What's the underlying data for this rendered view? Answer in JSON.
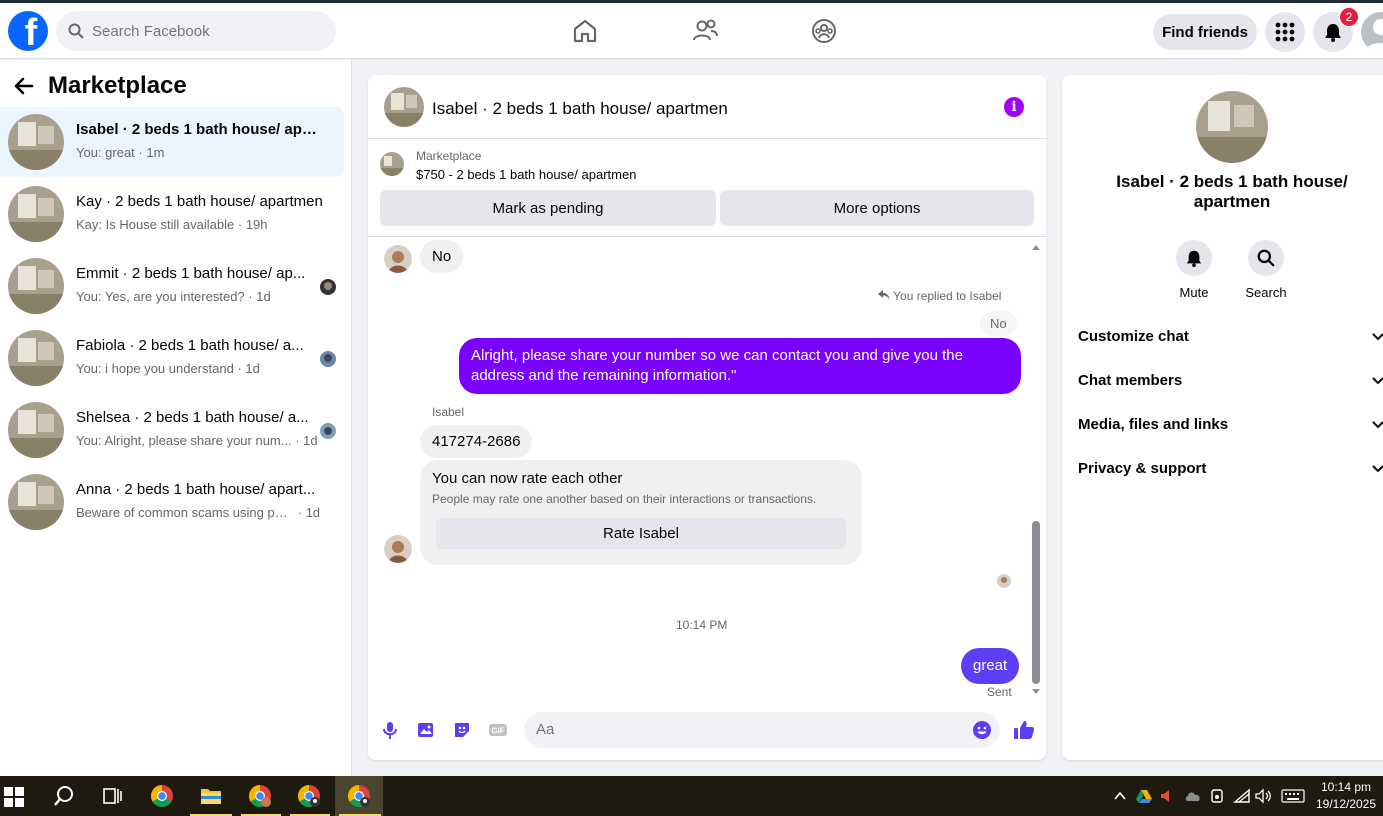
{
  "topbar": {
    "search_placeholder": "Search Facebook",
    "find_friends": "Find friends",
    "notifications_count": "2"
  },
  "left": {
    "title": "Marketplace",
    "conversations": [
      {
        "title": "Isabel · 2 beds 1 bath house/ apart...",
        "snippet": "You: great",
        "time": "· 1m",
        "active": true,
        "unread": true
      },
      {
        "title": "Kay · 2 beds 1 bath house/ apartmen",
        "snippet": "Kay: Is House still available",
        "time": "· 19h"
      },
      {
        "title": "Emmit · 2 beds 1 bath house/ ap...",
        "snippet": "You: Yes, are you interested?",
        "time": "· 1d"
      },
      {
        "title": "Fabiola · 2 beds 1 bath house/ a...",
        "snippet": "You: i hope you understand",
        "time": "· 1d"
      },
      {
        "title": "Shelsea · 2 beds 1 bath house/ a...",
        "snippet": "You: Alright, please share your num...",
        "time": "· 1d"
      },
      {
        "title": "Anna · 2 beds 1 bath house/ apart...",
        "snippet": "Beware of common scams using pay...",
        "time": "· 1d"
      }
    ]
  },
  "chat": {
    "header_name": "Isabel · 2 beds 1 bath house/ apartmen",
    "marketplace_label": "Marketplace",
    "listing": "$750 - 2 beds 1 bath house/ apartmen",
    "mark_pending": "Mark as pending",
    "more_options": "More options",
    "messages": {
      "no": "No",
      "replied_to": "You replied to Isabel",
      "quoted": "No",
      "outgoing_long": "Alright, please share your number so we can contact you and give you the address and the remaining information.\"",
      "sender": "Isabel",
      "phone": "417274-2686",
      "rate_title": "You can now rate each other",
      "rate_desc": "People may rate one another based on their interactions or transactions.",
      "rate_button": "Rate Isabel",
      "timestamp": "10:14 PM",
      "great": "great",
      "status": "Sent"
    },
    "composer_placeholder": "Aa"
  },
  "right": {
    "name": "Isabel · 2 beds 1 bath house/ apartmen",
    "mute": "Mute",
    "search": "Search",
    "sections": [
      "Customize chat",
      "Chat members",
      "Media, files and links",
      "Privacy & support"
    ]
  },
  "taskbar": {
    "time": "10:14 pm",
    "date": "19/12/2025"
  },
  "colors": {
    "accent": "#7a00ff",
    "fb_blue": "#0866ff",
    "badge_red": "#e41e3f"
  }
}
